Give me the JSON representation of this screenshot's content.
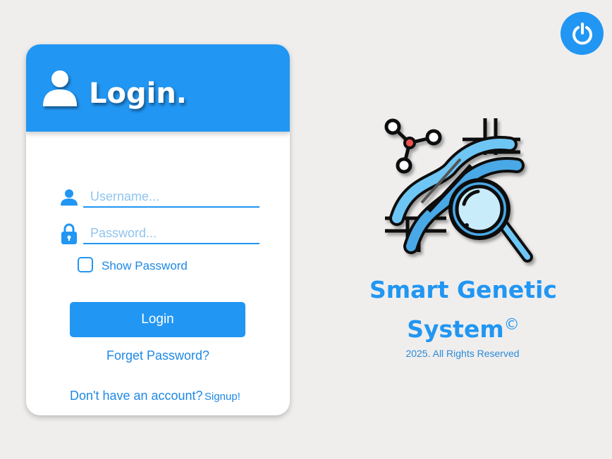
{
  "power": {
    "icon": "power-icon"
  },
  "login": {
    "title": "Login.",
    "username_placeholder": "Username...",
    "password_placeholder": "Password...",
    "show_password_label": "Show Password",
    "login_button": "Login",
    "forget_password": "Forget Password?",
    "no_account_text": "Don't have an account?",
    "signup_link": "Signup!"
  },
  "brand": {
    "title_line1": "Smart Genetic",
    "title_line2": "System",
    "copyright_symbol": "©",
    "copyright_text": "2025. All Rights Reserved",
    "logo_icon": "dna-magnifier-icon"
  },
  "colors": {
    "accent": "#2196f3",
    "background": "#efeeed",
    "card": "#ffffff"
  }
}
